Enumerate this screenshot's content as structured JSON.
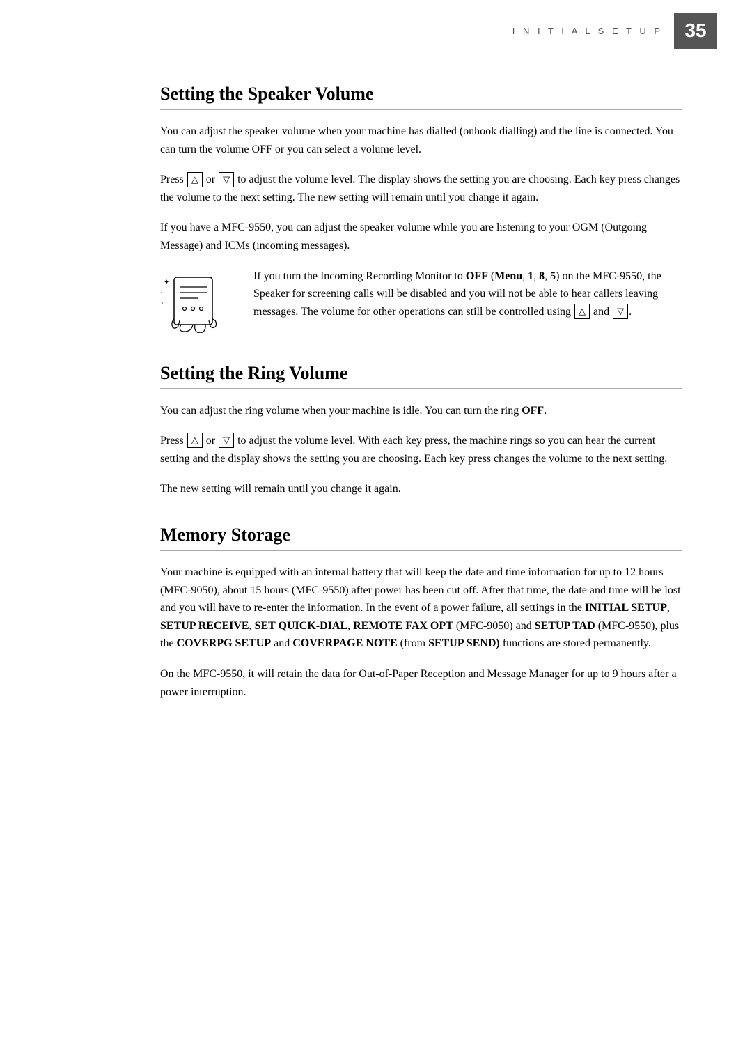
{
  "header": {
    "label": "I N I T I A L   S E T U P",
    "page_number": "35"
  },
  "sections": {
    "speaker_volume": {
      "heading": "Setting the Speaker Volume",
      "para1": "You can adjust the speaker volume when your machine has dialled (onhook dialling) and the line is connected. You can turn the volume OFF or you can select a volume level.",
      "para2_prefix": "Press ",
      "para2_suffix": " to adjust the volume level. The display shows the setting you are choosing. Each key press changes the volume to the next setting. The new setting will remain until you change it again.",
      "para3": "If you have a MFC-9550, you can adjust the speaker volume while you are listening to your OGM (Outgoing Message) and ICMs (incoming messages).",
      "para4_text": "If you turn the Incoming Recording Monitor to OFF (Menu, 1, 8, 5) on the MFC-9550, the Speaker for screening calls will be disabled and you will not be able to hear callers leaving messages. The volume for other operations can still be controlled using",
      "para4_suffix": "and",
      "para4_bold_parts": [
        "OFF",
        "Menu",
        "1",
        "8",
        "5"
      ]
    },
    "ring_volume": {
      "heading": "Setting the Ring Volume",
      "para1_prefix": "You can adjust the ring volume when your machine is idle. You can turn the ring ",
      "para1_bold": "OFF",
      "para1_suffix": ".",
      "para2_prefix": "Press ",
      "para2_suffix": " to adjust the volume level. With each key press, the machine rings so you can hear the current setting and the display shows the setting you are choosing. Each key press changes the volume to the next setting.",
      "para3": "The new setting will remain until you change it again."
    },
    "memory_storage": {
      "heading": "Memory Storage",
      "para1": "Your machine is equipped with an internal battery that will keep the date and time information for up to 12 hours (MFC-9050), about 15 hours (MFC-9550) after power has been cut off. After that time, the date and time will be lost and you will have to re-enter the information. In the event of a power failure, all settings in the INITIAL SETUP, SETUP RECEIVE, SET QUICK-DIAL, REMOTE FAX OPT (MFC-9050) and SETUP TAD (MFC-9550), plus the COVERPG SETUP and COVERPAGE NOTE (from SETUP SEND) functions are stored permanently.",
      "para2": "On the MFC-9550, it will retain the data for Out-of-Paper Reception and Message Manager for up to 9 hours after a power interruption."
    }
  }
}
